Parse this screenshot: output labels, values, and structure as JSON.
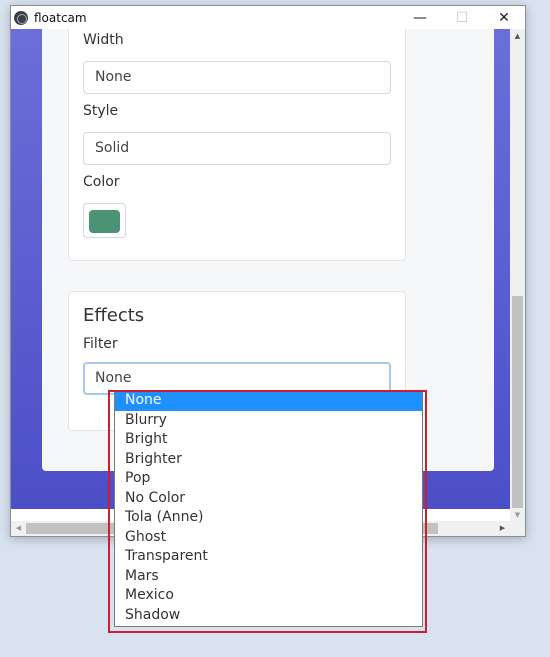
{
  "window": {
    "title": "floatcam",
    "controls": {
      "minimize": "—",
      "maximize": "☐",
      "close": "✕"
    }
  },
  "border_section": {
    "width_label": "Width",
    "width_value": "None",
    "style_label": "Style",
    "style_value": "Solid",
    "color_label": "Color",
    "color_value": "#4a9475"
  },
  "effects_section": {
    "title": "Effects",
    "filter_label": "Filter",
    "filter_value": "None",
    "filter_options": [
      "None",
      "Blurry",
      "Bright",
      "Brighter",
      "Pop",
      "No Color",
      "Tola (Anne)",
      "Ghost",
      "Transparent",
      "Mars",
      "Mexico",
      "Shadow"
    ],
    "selected_index": 0
  },
  "scrollbars": {
    "up": "▲",
    "down": "▼",
    "left": "◀",
    "right": "▶"
  },
  "colors": {
    "accent_selected": "#1e90ff",
    "highlight_border": "#cc2030",
    "background_gradient_top": "#6a6fd9",
    "background_gradient_bottom": "#4b4ec6"
  }
}
